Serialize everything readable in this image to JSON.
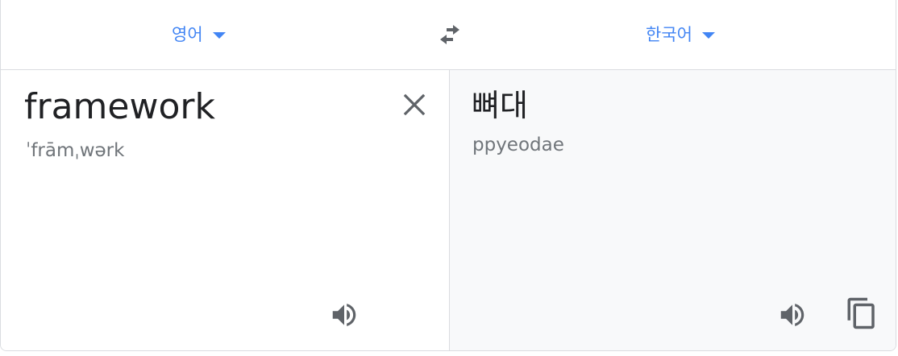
{
  "languages": {
    "source_label": "영어",
    "target_label": "한국어"
  },
  "source": {
    "text": "framework",
    "phonetic": "ˈfrāmˌwərk"
  },
  "target": {
    "text": "뼈대",
    "romanization": "ppyeodae"
  },
  "icons": {
    "swap": "swap-horiz-icon",
    "clear": "close-icon",
    "source_speaker": "volume-up-icon",
    "target_speaker": "volume-up-icon",
    "copy": "content-copy-icon",
    "dropdown": "caret-down-icon"
  },
  "colors": {
    "accent": "#4285f4",
    "text_primary": "#202124",
    "text_secondary": "#70757a",
    "icon": "#5f6368",
    "border": "#dadce0",
    "target_background": "#f8f9fa"
  }
}
